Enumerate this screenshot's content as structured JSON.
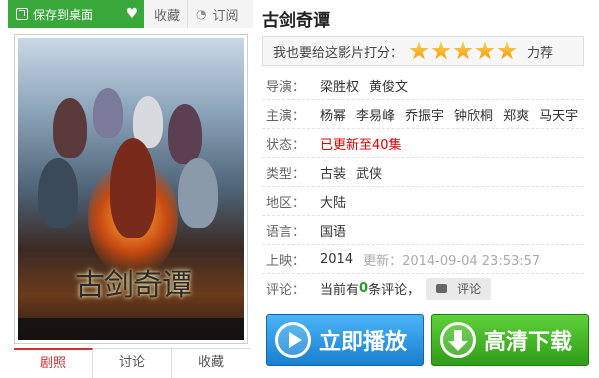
{
  "toolbar": {
    "save_label": "保存到桌面",
    "fav_label": "收藏",
    "subscribe_label": "订阅"
  },
  "movie": {
    "title": "古剑奇谭",
    "poster_title": "古剑奇谭"
  },
  "rating": {
    "prompt": "我也要给这影片打分：",
    "stars": 5,
    "stars_max": 5,
    "recommend": "力荐"
  },
  "info": {
    "director_label": "导演：",
    "directors": [
      "梁胜权",
      "黄俊文"
    ],
    "cast_label": "主演：",
    "cast": [
      "杨幂",
      "李易峰",
      "乔振宇",
      "钟欣桐",
      "郑爽",
      "马天宇"
    ],
    "status_label": "状态：",
    "status": "已更新至40集",
    "genre_label": "类型：",
    "genres": [
      "古装",
      "武侠"
    ],
    "region_label": "地区：",
    "region": "大陆",
    "language_label": "语言：",
    "language": "国语",
    "release_label": "上映：",
    "release_year": "2014",
    "updated": "更新：2014-09-04 23:53:57",
    "comments_label": "评论：",
    "comments_prefix": "当前有",
    "comments_count": "0",
    "comments_suffix": "条评论，",
    "comment_button": "评论"
  },
  "actions": {
    "play": "立即播放",
    "download": "高清下载"
  },
  "tabs": [
    "剧照",
    "讨论",
    "收藏"
  ],
  "colors": {
    "save_green": "#39a83a",
    "status_red": "#dd0000",
    "play_blue": "#1a7fd0",
    "download_green": "#2f9e18",
    "star_gold": "#f5a623"
  },
  "icons": {
    "save": "save-to-desktop-icon",
    "fav": "heart-icon",
    "subscribe": "rss-icon",
    "comment": "speech-bubble-icon",
    "play": "play-circle-icon",
    "download": "download-arrow-icon"
  }
}
